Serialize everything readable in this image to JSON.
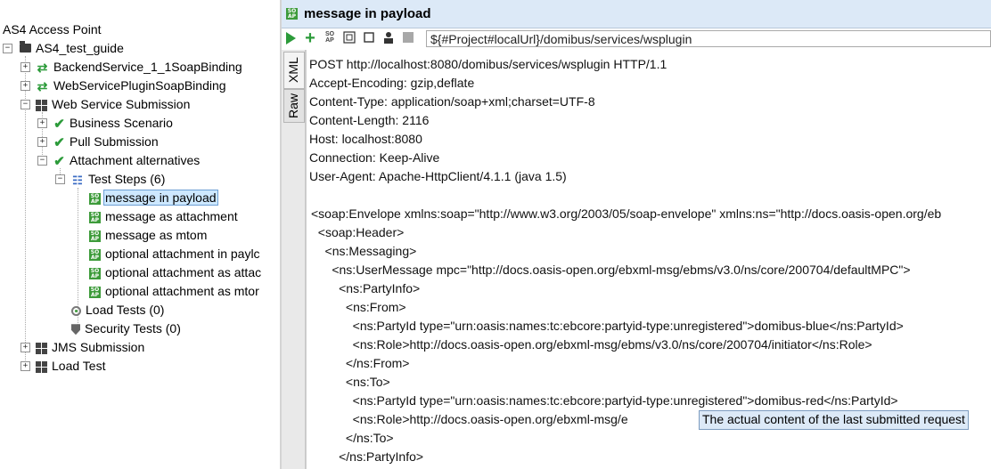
{
  "tree": {
    "root": "AS4 Access Point",
    "project": "AS4_test_guide",
    "interfaces": [
      "BackendService_1_1SoapBinding",
      "WebServicePluginSoapBinding"
    ],
    "suite": "Web Service Submission",
    "cases": [
      "Business Scenario",
      "Pull Submission",
      "Attachment alternatives"
    ],
    "test_steps_label": "Test Steps (6)",
    "steps": [
      "message in payload",
      "message as attachment",
      "message as mtom",
      "optional attachment in paylc",
      "optional attachment as attac",
      "optional attachment as mtor"
    ],
    "load_tests": "Load Tests (0)",
    "security_tests": "Security Tests (0)",
    "other_suites": [
      "JMS Submission",
      "Load Test"
    ]
  },
  "editor": {
    "title": "message in payload",
    "endpoint": "${#Project#localUrl}/domibus/services/wsplugin",
    "tabs": [
      "XML",
      "Raw"
    ],
    "raw_lines": [
      "POST http://localhost:8080/domibus/services/wsplugin HTTP/1.1",
      "Accept-Encoding: gzip,deflate",
      "Content-Type: application/soap+xml;charset=UTF-8",
      "Content-Length: 2116",
      "Host: localhost:8080",
      "Connection: Keep-Alive",
      "User-Agent: Apache-HttpClient/4.1.1 (java 1.5)",
      "",
      "<soap:Envelope xmlns:soap=\"http://www.w3.org/2003/05/soap-envelope\" xmlns:ns=\"http://docs.oasis-open.org/eb",
      "  <soap:Header>",
      "    <ns:Messaging>",
      "      <ns:UserMessage mpc=\"http://docs.oasis-open.org/ebxml-msg/ebms/v3.0/ns/core/200704/defaultMPC\">",
      "        <ns:PartyInfo>",
      "          <ns:From>",
      "            <ns:PartyId type=\"urn:oasis:names:tc:ebcore:partyid-type:unregistered\">domibus-blue</ns:PartyId>",
      "            <ns:Role>http://docs.oasis-open.org/ebxml-msg/ebms/v3.0/ns/core/200704/initiator</ns:Role>",
      "          </ns:From>",
      "          <ns:To>",
      "            <ns:PartyId type=\"urn:oasis:names:tc:ebcore:partyid-type:unregistered\">domibus-red</ns:PartyId>",
      "            <ns:Role>http://docs.oasis-open.org/ebxml-msg/e",
      "          </ns:To>",
      "        </ns:PartyInfo>"
    ],
    "tooltip": "The actual content of the last submitted request"
  }
}
